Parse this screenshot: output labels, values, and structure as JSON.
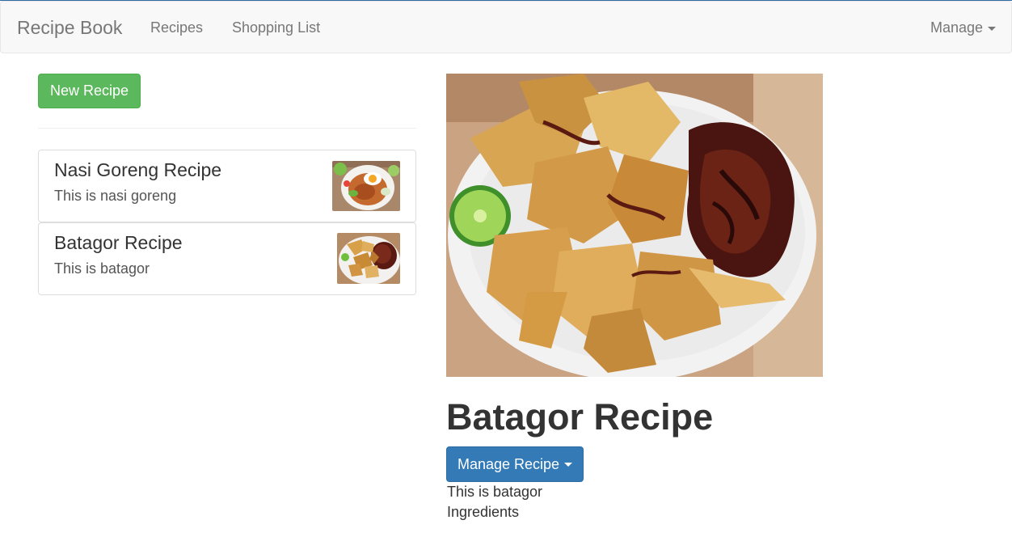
{
  "navbar": {
    "brand": "Recipe Book",
    "links": [
      "Recipes",
      "Shopping List"
    ],
    "manage_label": "Manage"
  },
  "sidebar": {
    "new_recipe_label": "New Recipe",
    "recipes": [
      {
        "title": "Nasi Goreng Recipe",
        "description": "This is nasi goreng",
        "image_icon": "nasi-goreng-photo"
      },
      {
        "title": "Batagor Recipe",
        "description": "This is batagor",
        "image_icon": "batagor-photo"
      }
    ]
  },
  "detail": {
    "title": "Batagor Recipe",
    "manage_button_label": "Manage Recipe",
    "description": "This is batagor",
    "ingredients_label": "Ingredients",
    "image_icon": "batagor-photo"
  },
  "colors": {
    "success": "#5cb85c",
    "primary": "#337ab7",
    "navbar_bg": "#f8f8f8"
  }
}
